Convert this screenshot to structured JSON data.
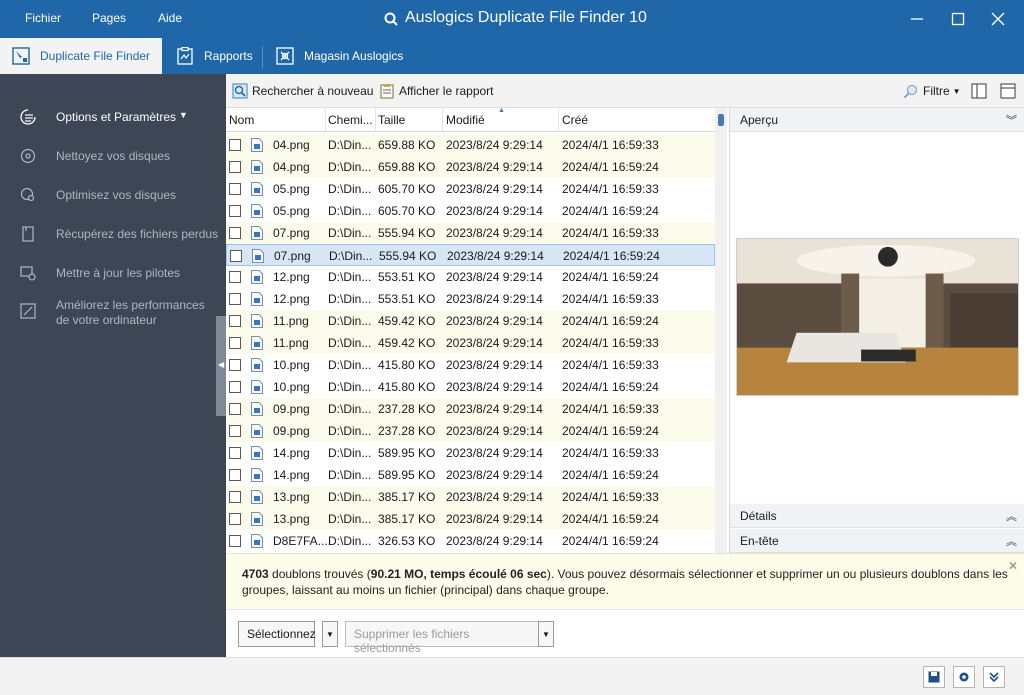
{
  "menu": {
    "file": "Fichier",
    "pages": "Pages",
    "help": "Aide"
  },
  "app_title": "Auslogics Duplicate File Finder 10",
  "tabs": [
    {
      "label": "Duplicate File Finder"
    },
    {
      "label": "Rapports"
    },
    {
      "label": "Magasin Auslogics"
    }
  ],
  "sidebar": {
    "items": [
      {
        "label": "Options et Paramètres",
        "icon": "options-icon"
      },
      {
        "label": "Nettoyez vos disques",
        "icon": "disk-clean-icon"
      },
      {
        "label": "Optimisez vos disques",
        "icon": "disk-optimize-icon"
      },
      {
        "label": "Récupérez des fichiers perdus",
        "icon": "file-recover-icon"
      },
      {
        "label": "Mettre à jour les pilotes",
        "icon": "driver-update-icon"
      },
      {
        "label_line1": "Améliorez les performances",
        "label_line2": "de votre ordinateur",
        "icon": "performance-icon"
      }
    ]
  },
  "toolbar": {
    "rescan": "Rechercher à nouveau",
    "show_report": "Afficher le rapport",
    "filter": "Filtre"
  },
  "table": {
    "columns": {
      "name": "Nom",
      "path": "Chemi...",
      "size": "Taille",
      "modified": "Modifié",
      "created": "Créé"
    },
    "rows": [
      {
        "name": "04.png",
        "path": "D:\\Din...",
        "size": "659.88 KO",
        "modified": "2023/8/24 9:29:14",
        "created": "2024/4/1 16:59:33"
      },
      {
        "name": "04.png",
        "path": "D:\\Din...",
        "size": "659.88 KO",
        "modified": "2023/8/24 9:29:14",
        "created": "2024/4/1 16:59:24"
      },
      {
        "name": "05.png",
        "path": "D:\\Din...",
        "size": "605.70 KO",
        "modified": "2023/8/24 9:29:14",
        "created": "2024/4/1 16:59:33"
      },
      {
        "name": "05.png",
        "path": "D:\\Din...",
        "size": "605.70 KO",
        "modified": "2023/8/24 9:29:14",
        "created": "2024/4/1 16:59:24"
      },
      {
        "name": "07.png",
        "path": "D:\\Din...",
        "size": "555.94 KO",
        "modified": "2023/8/24 9:29:14",
        "created": "2024/4/1 16:59:33"
      },
      {
        "name": "07.png",
        "path": "D:\\Din...",
        "size": "555.94 KO",
        "modified": "2023/8/24 9:29:14",
        "created": "2024/4/1 16:59:24"
      },
      {
        "name": "12.png",
        "path": "D:\\Din...",
        "size": "553.51 KO",
        "modified": "2023/8/24 9:29:14",
        "created": "2024/4/1 16:59:24"
      },
      {
        "name": "12.png",
        "path": "D:\\Din...",
        "size": "553.51 KO",
        "modified": "2023/8/24 9:29:14",
        "created": "2024/4/1 16:59:33"
      },
      {
        "name": "11.png",
        "path": "D:\\Din...",
        "size": "459.42 KO",
        "modified": "2023/8/24 9:29:14",
        "created": "2024/4/1 16:59:24"
      },
      {
        "name": "11.png",
        "path": "D:\\Din...",
        "size": "459.42 KO",
        "modified": "2023/8/24 9:29:14",
        "created": "2024/4/1 16:59:33"
      },
      {
        "name": "10.png",
        "path": "D:\\Din...",
        "size": "415.80 KO",
        "modified": "2023/8/24 9:29:14",
        "created": "2024/4/1 16:59:33"
      },
      {
        "name": "10.png",
        "path": "D:\\Din...",
        "size": "415.80 KO",
        "modified": "2023/8/24 9:29:14",
        "created": "2024/4/1 16:59:24"
      },
      {
        "name": "09.png",
        "path": "D:\\Din...",
        "size": "237.28 KO",
        "modified": "2023/8/24 9:29:14",
        "created": "2024/4/1 16:59:33"
      },
      {
        "name": "09.png",
        "path": "D:\\Din...",
        "size": "237.28 KO",
        "modified": "2023/8/24 9:29:14",
        "created": "2024/4/1 16:59:24"
      },
      {
        "name": "14.png",
        "path": "D:\\Din...",
        "size": "589.95 KO",
        "modified": "2023/8/24 9:29:14",
        "created": "2024/4/1 16:59:33"
      },
      {
        "name": "14.png",
        "path": "D:\\Din...",
        "size": "589.95 KO",
        "modified": "2023/8/24 9:29:14",
        "created": "2024/4/1 16:59:24"
      },
      {
        "name": "13.png",
        "path": "D:\\Din...",
        "size": "385.17 KO",
        "modified": "2023/8/24 9:29:14",
        "created": "2024/4/1 16:59:33"
      },
      {
        "name": "13.png",
        "path": "D:\\Din...",
        "size": "385.17 KO",
        "modified": "2023/8/24 9:29:14",
        "created": "2024/4/1 16:59:24"
      },
      {
        "name": "D8E7FA....",
        "path": "D:\\Din...",
        "size": "326.53 KO",
        "modified": "2023/8/24 9:29:14",
        "created": "2024/4/1 16:59:24"
      }
    ]
  },
  "preview": {
    "title": "Aperçu",
    "details": "Détails",
    "header": "En-tête"
  },
  "status": {
    "count": "4703",
    "text1": " doublons trouvés (",
    "bold2": "90.21 MO, temps écoulé 06 sec",
    "text3": "). Vous pouvez désormais sélectionner et supprimer un ou plusieurs doublons dans les groupes, laissant au moins un fichier (principal) dans chaque groupe."
  },
  "actions": {
    "select": "Sélectionnez",
    "delete_selected": "Supprimer les fichiers sélectionnés"
  },
  "colors": {
    "titlebar": "#1f67a8",
    "sidebar": "#3c4654",
    "row_alt": "#fbfbeb",
    "row_selected": "#d6e6f5"
  }
}
